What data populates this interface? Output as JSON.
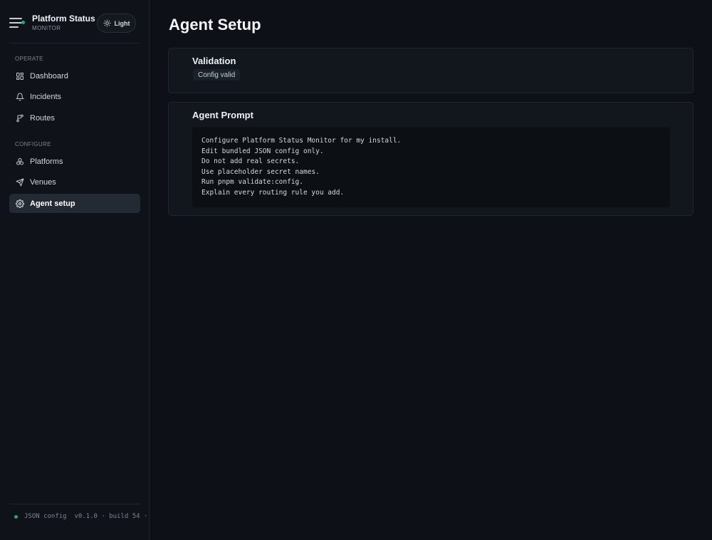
{
  "brand": {
    "title": "Platform Status",
    "subtitle": "MONITOR"
  },
  "theme_toggle": {
    "label": "Light",
    "icon": "sun-icon"
  },
  "sidebar": {
    "sections": [
      {
        "label": "OPERATE",
        "items": [
          {
            "label": "Dashboard",
            "icon": "grid-icon",
            "active": false
          },
          {
            "label": "Incidents",
            "icon": "bell-icon",
            "active": false
          },
          {
            "label": "Routes",
            "icon": "route-icon",
            "active": false
          }
        ]
      },
      {
        "label": "CONFIGURE",
        "items": [
          {
            "label": "Platforms",
            "icon": "platforms-icon",
            "active": false
          },
          {
            "label": "Venues",
            "icon": "send-icon",
            "active": false
          },
          {
            "label": "Agent setup",
            "icon": "gear-icon",
            "active": true
          }
        ]
      }
    ],
    "footer": {
      "text": "JSON config  v0.1.0 · build 54 ·",
      "status_color": "#2ea66b"
    }
  },
  "main": {
    "title": "Agent Setup",
    "validation": {
      "title": "Validation",
      "badge": "Config valid"
    },
    "prompt": {
      "title": "Agent Prompt",
      "lines": [
        "Configure Platform Status Monitor for my install.",
        "Edit bundled JSON config only.",
        "Do not add real secrets.",
        "Use placeholder secret names.",
        "Run pnpm validate:config.",
        "Explain every routing rule you add."
      ]
    }
  },
  "colors": {
    "background": "#0d1117",
    "sidebar": "#0f1319",
    "active_item": "#232a33",
    "card": "#12171e",
    "code_block": "#0c1015"
  }
}
